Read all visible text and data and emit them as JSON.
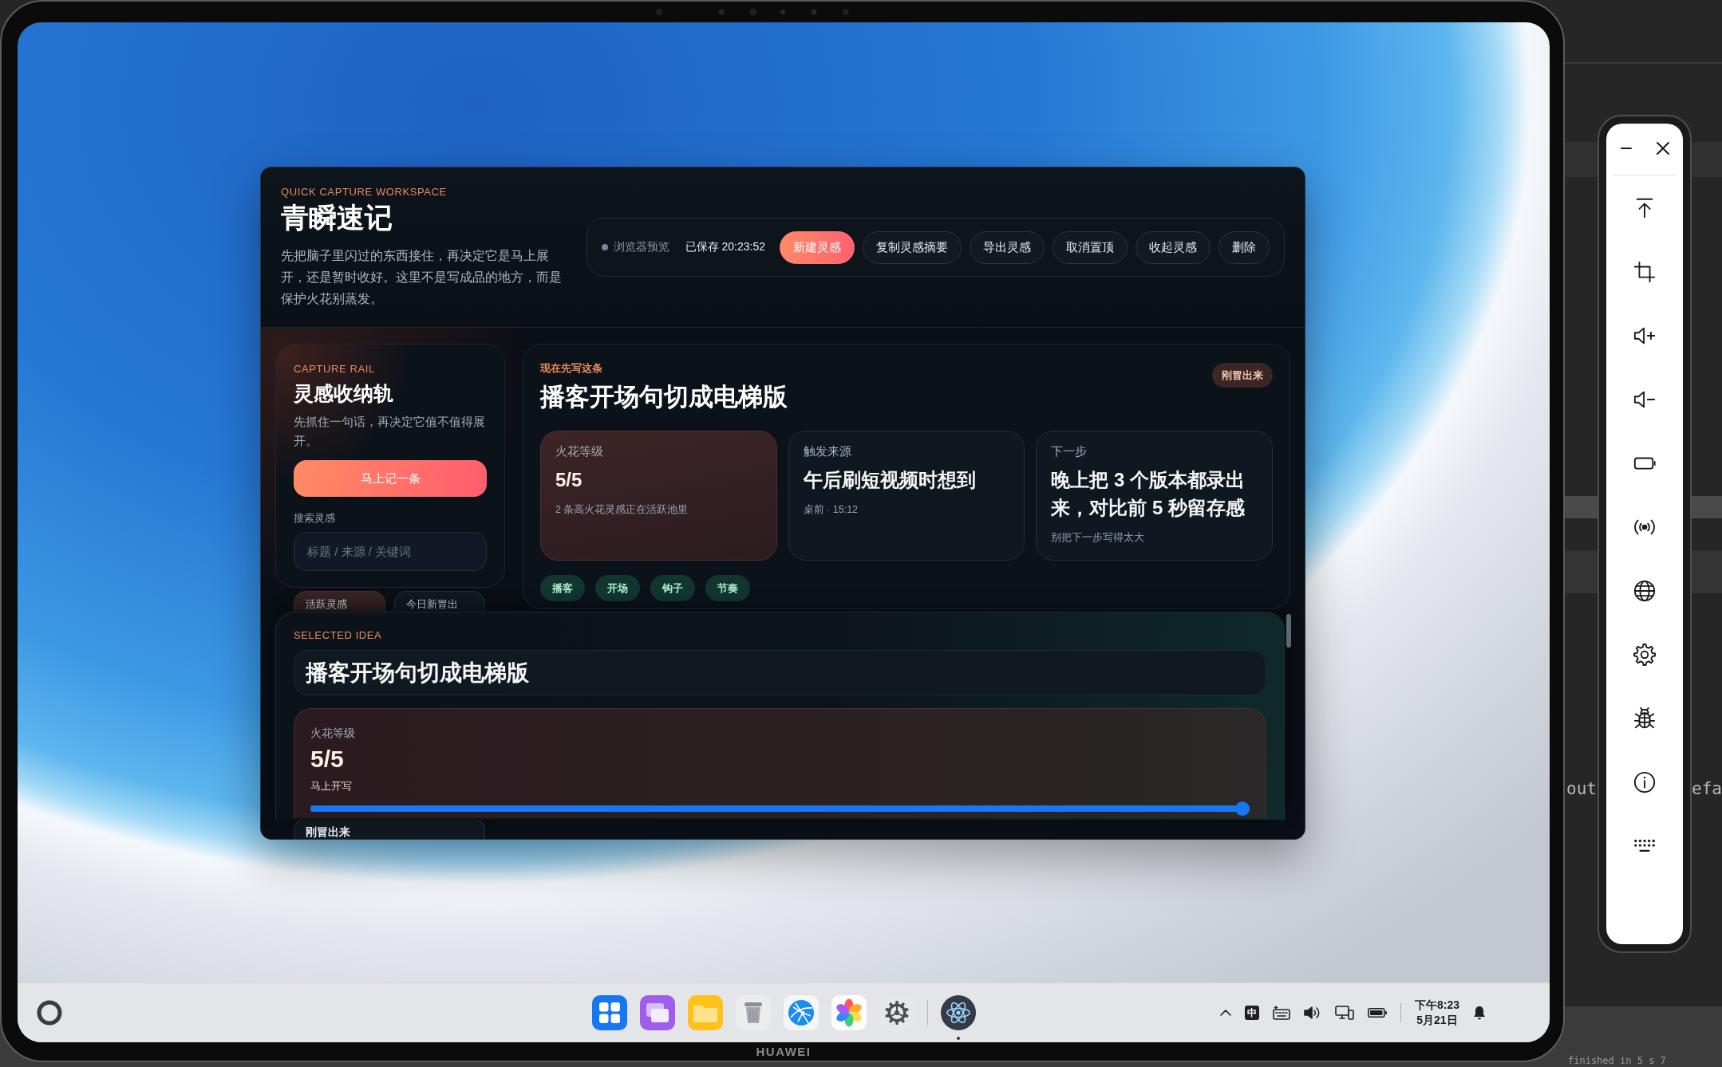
{
  "device": {
    "brand": "HUAWEI"
  },
  "editor": {
    "fragments": [
      "out",
      "efa",
      "finished in 5 s 7"
    ]
  },
  "app": {
    "header": {
      "eyebrow": "QUICK CAPTURE WORKSPACE",
      "title": "青瞬速记",
      "description": "先把脑子里闪过的东西接住，再决定它是马上展开，还是暂时收好。这里不是写成品的地方，而是保护火花别蒸发。"
    },
    "toolbar": {
      "mode": "浏览器预览",
      "saved": "已保存 20:23:52",
      "buttons": [
        {
          "label": "新建灵感",
          "kind": "primary"
        },
        {
          "label": "复制灵感摘要",
          "kind": "secondary"
        },
        {
          "label": "导出灵感",
          "kind": "secondary"
        },
        {
          "label": "取消置顶",
          "kind": "secondary"
        },
        {
          "label": "收起灵感",
          "kind": "secondary"
        },
        {
          "label": "删除",
          "kind": "secondary"
        }
      ]
    },
    "rail": {
      "eyebrow": "CAPTURE RAIL",
      "title": "灵感收纳轨",
      "description": "先抓住一句话，再决定它值不值得展开。",
      "action": "马上记一条",
      "search_label": "搜索灵感",
      "search": {
        "placeholder": "标题 / 来源 / 关键词"
      },
      "stats": [
        {
          "label": "活跃灵感",
          "highlighted": true
        },
        {
          "label": "今日新冒出",
          "highlighted": false
        }
      ],
      "list": [
        {
          "title": "刚冒出来"
        }
      ]
    },
    "focus": {
      "eyebrow": "现在先写这条",
      "title": "播客开场句切成电梯版",
      "badge": "刚冒出来",
      "metrics": [
        {
          "label": "火花等级",
          "value": "5/5",
          "note": "2 条高火花灵感正在活跃池里",
          "kind": "spark"
        },
        {
          "label": "触发来源",
          "value": "午后刷短视频时想到",
          "note": "桌前 · 15:12",
          "kind": "plain"
        },
        {
          "label": "下一步",
          "value": "晚上把 3 个版本都录出来，对比前 5 秒留存感",
          "note": "别把下一步写得太大",
          "kind": "plain"
        }
      ],
      "tags": [
        "播客",
        "开场",
        "钩子",
        "节奏"
      ]
    },
    "selected": {
      "eyebrow": "SELECTED IDEA",
      "title_field": {
        "value": "播客开场句切成电梯版"
      },
      "spark": {
        "label": "火花等级",
        "value": "5/5",
        "hint": "马上开写",
        "level": 1
      }
    }
  },
  "dock": {
    "apps": [
      {
        "running": false
      },
      {
        "running": false
      },
      {
        "running": false
      },
      {
        "running": false
      },
      {
        "running": false
      },
      {
        "running": false
      },
      {
        "running": false
      },
      {
        "running": true
      }
    ]
  },
  "tray": {
    "ime": "中",
    "time": "下午8:23",
    "date": "5月21日"
  }
}
